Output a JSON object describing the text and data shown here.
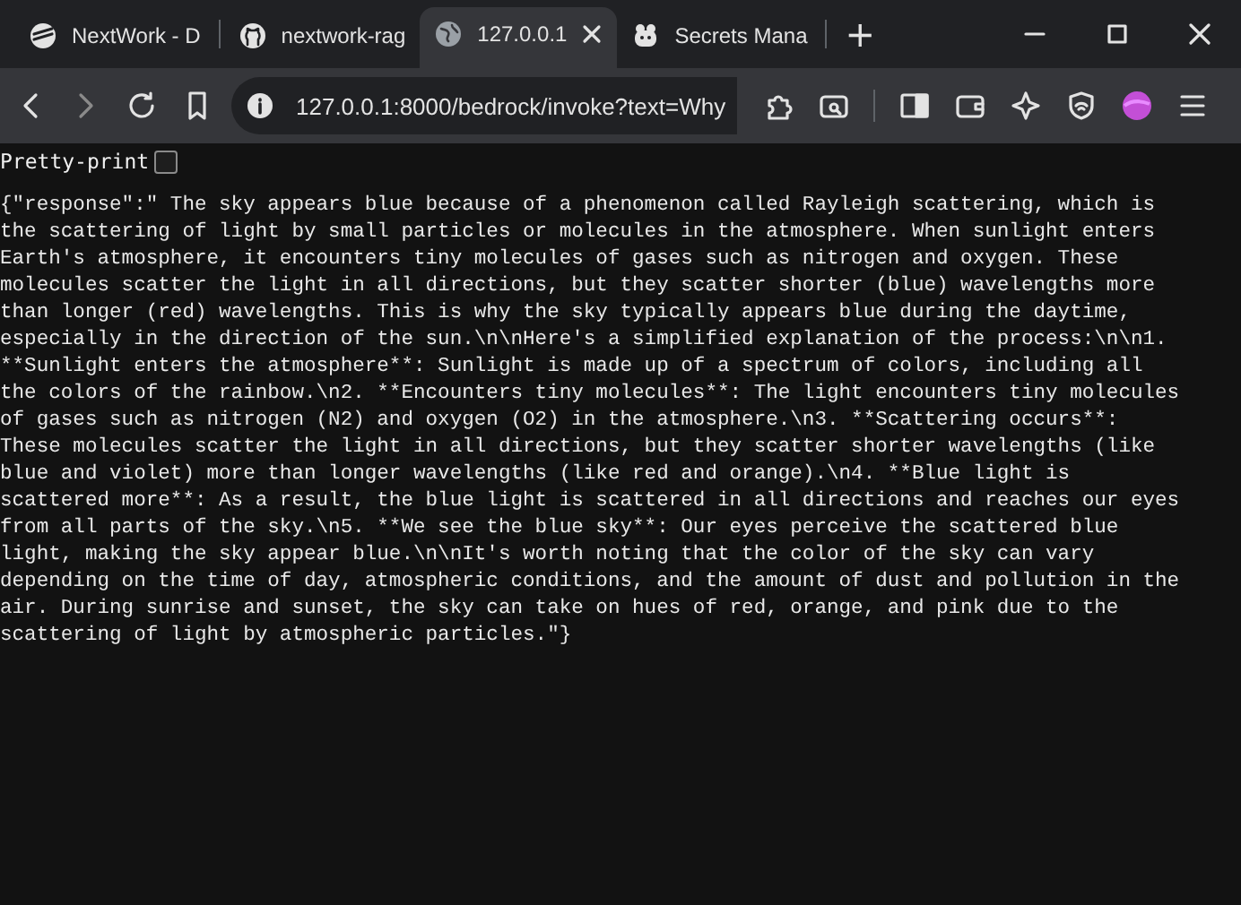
{
  "tabs": [
    {
      "title": "NextWork - D",
      "selected": false,
      "kind": "site"
    },
    {
      "title": "nextwork-rag",
      "selected": false,
      "kind": "github"
    },
    {
      "title": "127.0.0.1",
      "selected": true,
      "kind": "globe"
    },
    {
      "title": "Secrets Mana",
      "selected": false,
      "kind": "bot"
    }
  ],
  "new_tab": "+",
  "address": "127.0.0.1:8000/bedrock/invoke?text=Why",
  "pretty_print": {
    "label": "Pretty-print",
    "checked": false
  },
  "response_lines": [
    "{\"response\":\" The sky appears blue because of a phenomenon called Rayleigh scattering, which is",
    "the scattering of light by small particles or molecules in the atmosphere. When sunlight enters",
    "Earth's atmosphere, it encounters tiny molecules of gases such as nitrogen and oxygen. These",
    "molecules scatter the light in all directions, but they scatter shorter (blue) wavelengths more",
    "than longer (red) wavelengths. This is why the sky typically appears blue during the daytime,",
    "especially in the direction of the sun.\\n\\nHere's a simplified explanation of the process:\\n\\n1.",
    "**Sunlight enters the atmosphere**: Sunlight is made up of a spectrum of colors, including all",
    "the colors of the rainbow.\\n2. **Encounters tiny molecules**: The light encounters tiny molecules",
    "of gases such as nitrogen (N2) and oxygen (O2) in the atmosphere.\\n3. **Scattering occurs**:",
    "These molecules scatter the light in all directions, but they scatter shorter wavelengths (like",
    "blue and violet) more than longer wavelengths (like red and orange).\\n4. **Blue light is",
    "scattered more**: As a result, the blue light is scattered in all directions and reaches our eyes",
    "from all parts of the sky.\\n5. **We see the blue sky**: Our eyes perceive the scattered blue",
    "light, making the sky appear blue.\\n\\nIt's worth noting that the color of the sky can vary",
    "depending on the time of day, atmospheric conditions, and the amount of dust and pollution in the",
    "air. During sunrise and sunset, the sky can take on hues of red, orange, and pink due to the",
    "scattering of light by atmospheric particles.\"}"
  ]
}
